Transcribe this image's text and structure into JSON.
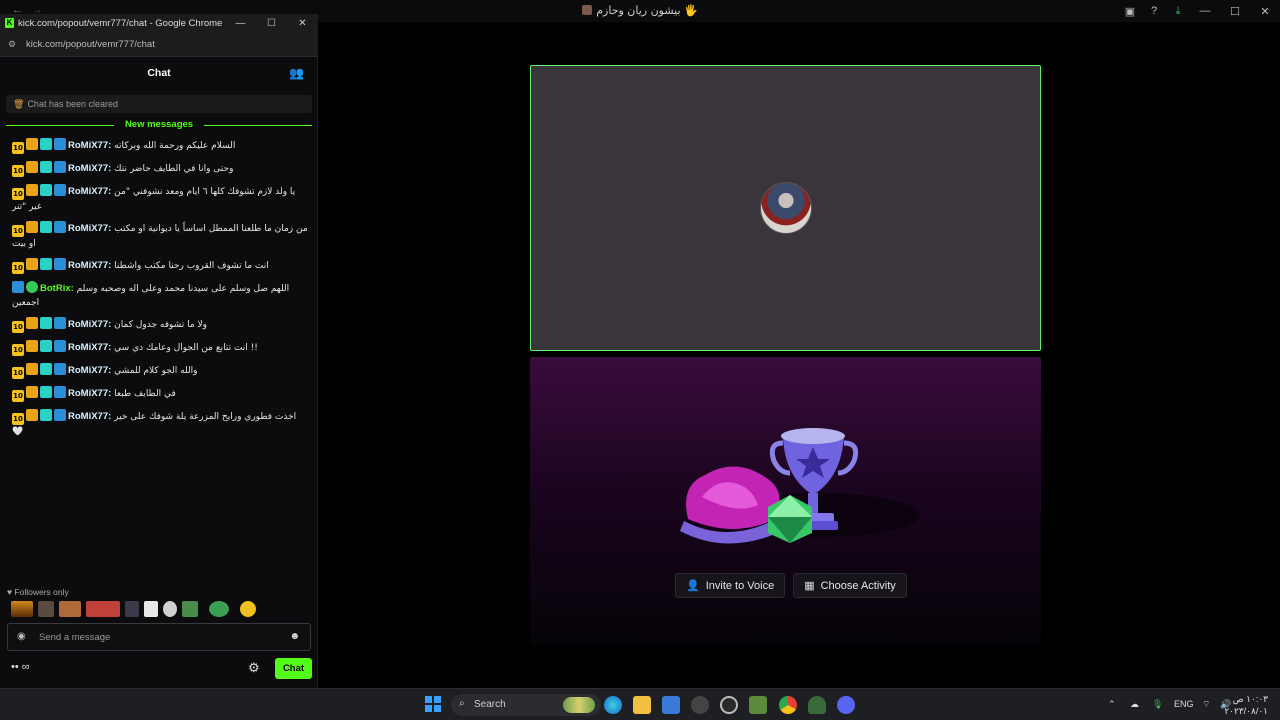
{
  "app": {
    "nav_back": "←",
    "nav_forward": "→",
    "window_title": "بيشون ريان وحازم 🖐",
    "icons": [
      "monitor-icon",
      "help-icon",
      "download-icon",
      "minimize-icon",
      "maximize-icon",
      "close-icon"
    ],
    "icon_glyphs": [
      "▣",
      "?",
      "⤓",
      "—",
      "☐",
      "✕"
    ]
  },
  "stage": {
    "accent": "#5ef06a",
    "invite_label": "Invite to Voice",
    "activity_label": "Choose Activity",
    "invite_icon": "👤",
    "activity_icon": "▦"
  },
  "chat_window": {
    "title": "kick.com/popout/vemr777/chat - Google Chrome",
    "url": "kick.com/popout/vemr777/chat",
    "min": "—",
    "max": "☐",
    "close": "✕",
    "header": "Chat",
    "cleared_text": "Chat has been cleared",
    "new_messages": "New messages",
    "messages": [
      {
        "user": "RoMiX77:",
        "text": "السلام عليكم ورحمة الله وبركاته",
        "type": "romix"
      },
      {
        "user": "RoMiX77:",
        "text": "وحتى وانا في الطايف حاضر نتك",
        "type": "romix"
      },
      {
        "user": "RoMiX77:",
        "text": "يا ولد لازم تشوفك كلها ٦ ايام ومعد نشوفني \"من غير \"تنر",
        "type": "romix"
      },
      {
        "user": "RoMiX77:",
        "text": "من زمان ما طلعنا الممطل اساساً يا ديوانية او مكتب او بيت",
        "type": "romix"
      },
      {
        "user": "RoMiX77:",
        "text": "انت ما تشوف القروب رحنا مكتب واشطنا",
        "type": "romix"
      },
      {
        "user": "BotRix:",
        "text": "اللهم صل وسلم على سيدنا محمد وعلى اله وصحبه وسلم اجمعين",
        "type": "botrix"
      },
      {
        "user": "RoMiX77:",
        "text": "ولا ما تشوفه جدول كمان",
        "type": "romix"
      },
      {
        "user": "RoMiX77:",
        "text": "انت تتابع من الجوال وعامك دي سي !!",
        "type": "romix"
      },
      {
        "user": "RoMiX77:",
        "text": "والله الجو كلام للمشي",
        "type": "romix"
      },
      {
        "user": "RoMiX77:",
        "text": "في الطايف طبعا",
        "type": "romix"
      },
      {
        "user": "RoMiX77:",
        "text": "اخذت فطوري ورايح المزرعة يلة شوفك على خير 🤍",
        "type": "romix"
      }
    ],
    "badge_sub": "10",
    "followers_only": "♥ Followers only",
    "send_placeholder": "Send a message",
    "send_button": "Chat",
    "bottom_left": "•• ∞",
    "gear": "⚙"
  },
  "taskbar": {
    "search_label": "Search",
    "lang": "ENG",
    "time": "١٠:٠٣ ص",
    "date": "٢٠٢٣/٠٨/٠١"
  }
}
